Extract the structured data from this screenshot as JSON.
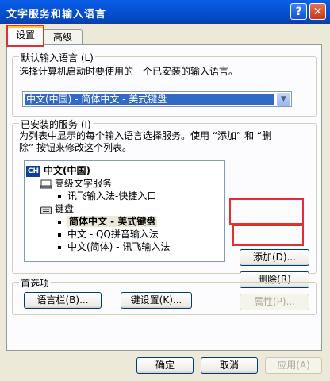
{
  "window": {
    "title": "文字服务和输入语言",
    "help_glyph": "?",
    "close_glyph": "✕"
  },
  "tabs": [
    {
      "label": "设置",
      "active": true
    },
    {
      "label": "高级",
      "active": false
    }
  ],
  "default_lang": {
    "group_label": "默认输入语言 (L)",
    "description": "选择计算机启动时要使用的一个已安装的输入语言。",
    "selected": "中文(中国) - 简体中文 - 美式键盘",
    "arrow": "▼"
  },
  "services": {
    "group_label": "已安装的服务 (I)",
    "description_line1": "为列表中显示的每个输入语言选择服务。使用 “添加” 和 “删",
    "description_line2": "除” 按钮来修改这个列表。",
    "tree": {
      "lang_badge": "CH",
      "lang": "中文(中国)",
      "advanced_header": "高级文字服务",
      "advanced_items": [
        "讯飞输入法-快捷入口"
      ],
      "keyboard_header": "键盘",
      "keyboard_items": [
        "简体中文 - 美式键盘",
        "中文 - QQ拼音输入法",
        "中文(简体) - 讯飞输入法"
      ],
      "selected_index": 0
    },
    "add_button": "添加(D)...",
    "remove_button": "删除(R)",
    "properties_button": "属性(P)..."
  },
  "preferences": {
    "group_label": "首选项",
    "language_bar_button": "语言栏(B)...",
    "key_settings_button": "键设置(K)..."
  },
  "footer": {
    "ok": "确定",
    "cancel": "取消",
    "apply": "应用(A)"
  },
  "accent_colors": {
    "highlight_box": "#e03030",
    "title_bar": "#0553d6",
    "selection": "#316ac5"
  }
}
